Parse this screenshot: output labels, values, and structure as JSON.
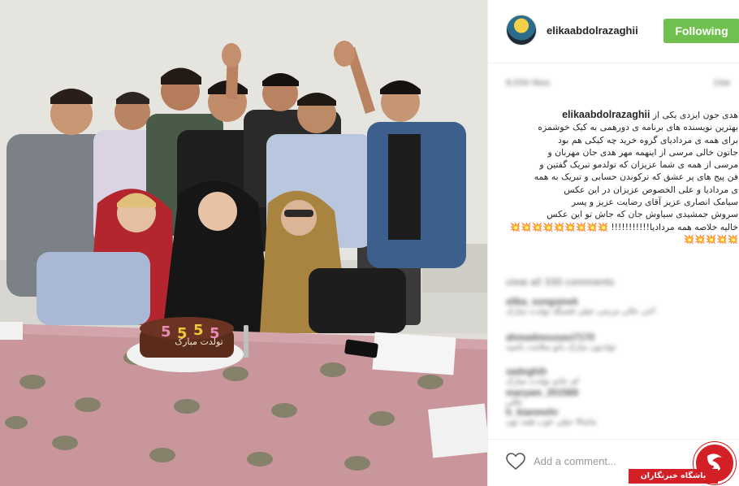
{
  "post": {
    "username": "elikaabdolrazaghii",
    "follow_label": "Following",
    "likes_text": "8,550 likes",
    "time_text": "10w",
    "caption_lines": [
      "هدی جون ایزدی یکی از",
      "بهترین نویسنده های برنامه ی دورهمی به کیک خوشمزه",
      "برای همه ی مردادیای گروه خرید چه کیکی هم بود",
      "جاتون خالی مرسی از اینهمه مهر هدی جان مهربان و",
      "مرسی از همه ی شما عزیزان که تولدمو تبریک گفتین و",
      "فن پیج های پر عشق که ترکوندن حسابی و تبریک به همه",
      "ی مردادیا و علی الخصوص عزیزان در این عکس",
      "سیامک انصاری عزیز آقای رضایت عزیز و پسر",
      "سروش جمشیدی سیاوش جان که جاش تو این عکس",
      "خالیه خلاصه همه مردادیا!!!!!!!!!!! 💥💥💥💥💥💥💥💥💥💥💥💥💥💥"
    ],
    "view_all": "view all 330 comments",
    "comments": [
      {
        "user": "elika_songsinek",
        "text": "آخی عالی مرسی خیلی قشنگه تولدت مبارک"
      },
      {
        "user": "ahmadmousavi7170",
        "text": "تولدتون مبارک بانو سلامت باشید"
      },
      {
        "user": "sadeghih",
        "text": "ای جانم تولدت مبارک"
      },
      {
        "user": "maryam_201569",
        "text": "عالی"
      },
      {
        "user": "h_kianmehr",
        "text": "ماشالا خیلی خوب همه تون"
      }
    ],
    "add_comment_placeholder": "Add a comment..."
  },
  "photo": {
    "cake_text": "تولدت مبارک",
    "candle_digits": [
      "5",
      "5",
      "5",
      "5"
    ]
  },
  "brand": {
    "label": "باشگاه خبرنگاران"
  },
  "colors": {
    "follow_button": "#70c050",
    "brand_red": "#d31f26",
    "tablecloth": "#c9969c"
  }
}
